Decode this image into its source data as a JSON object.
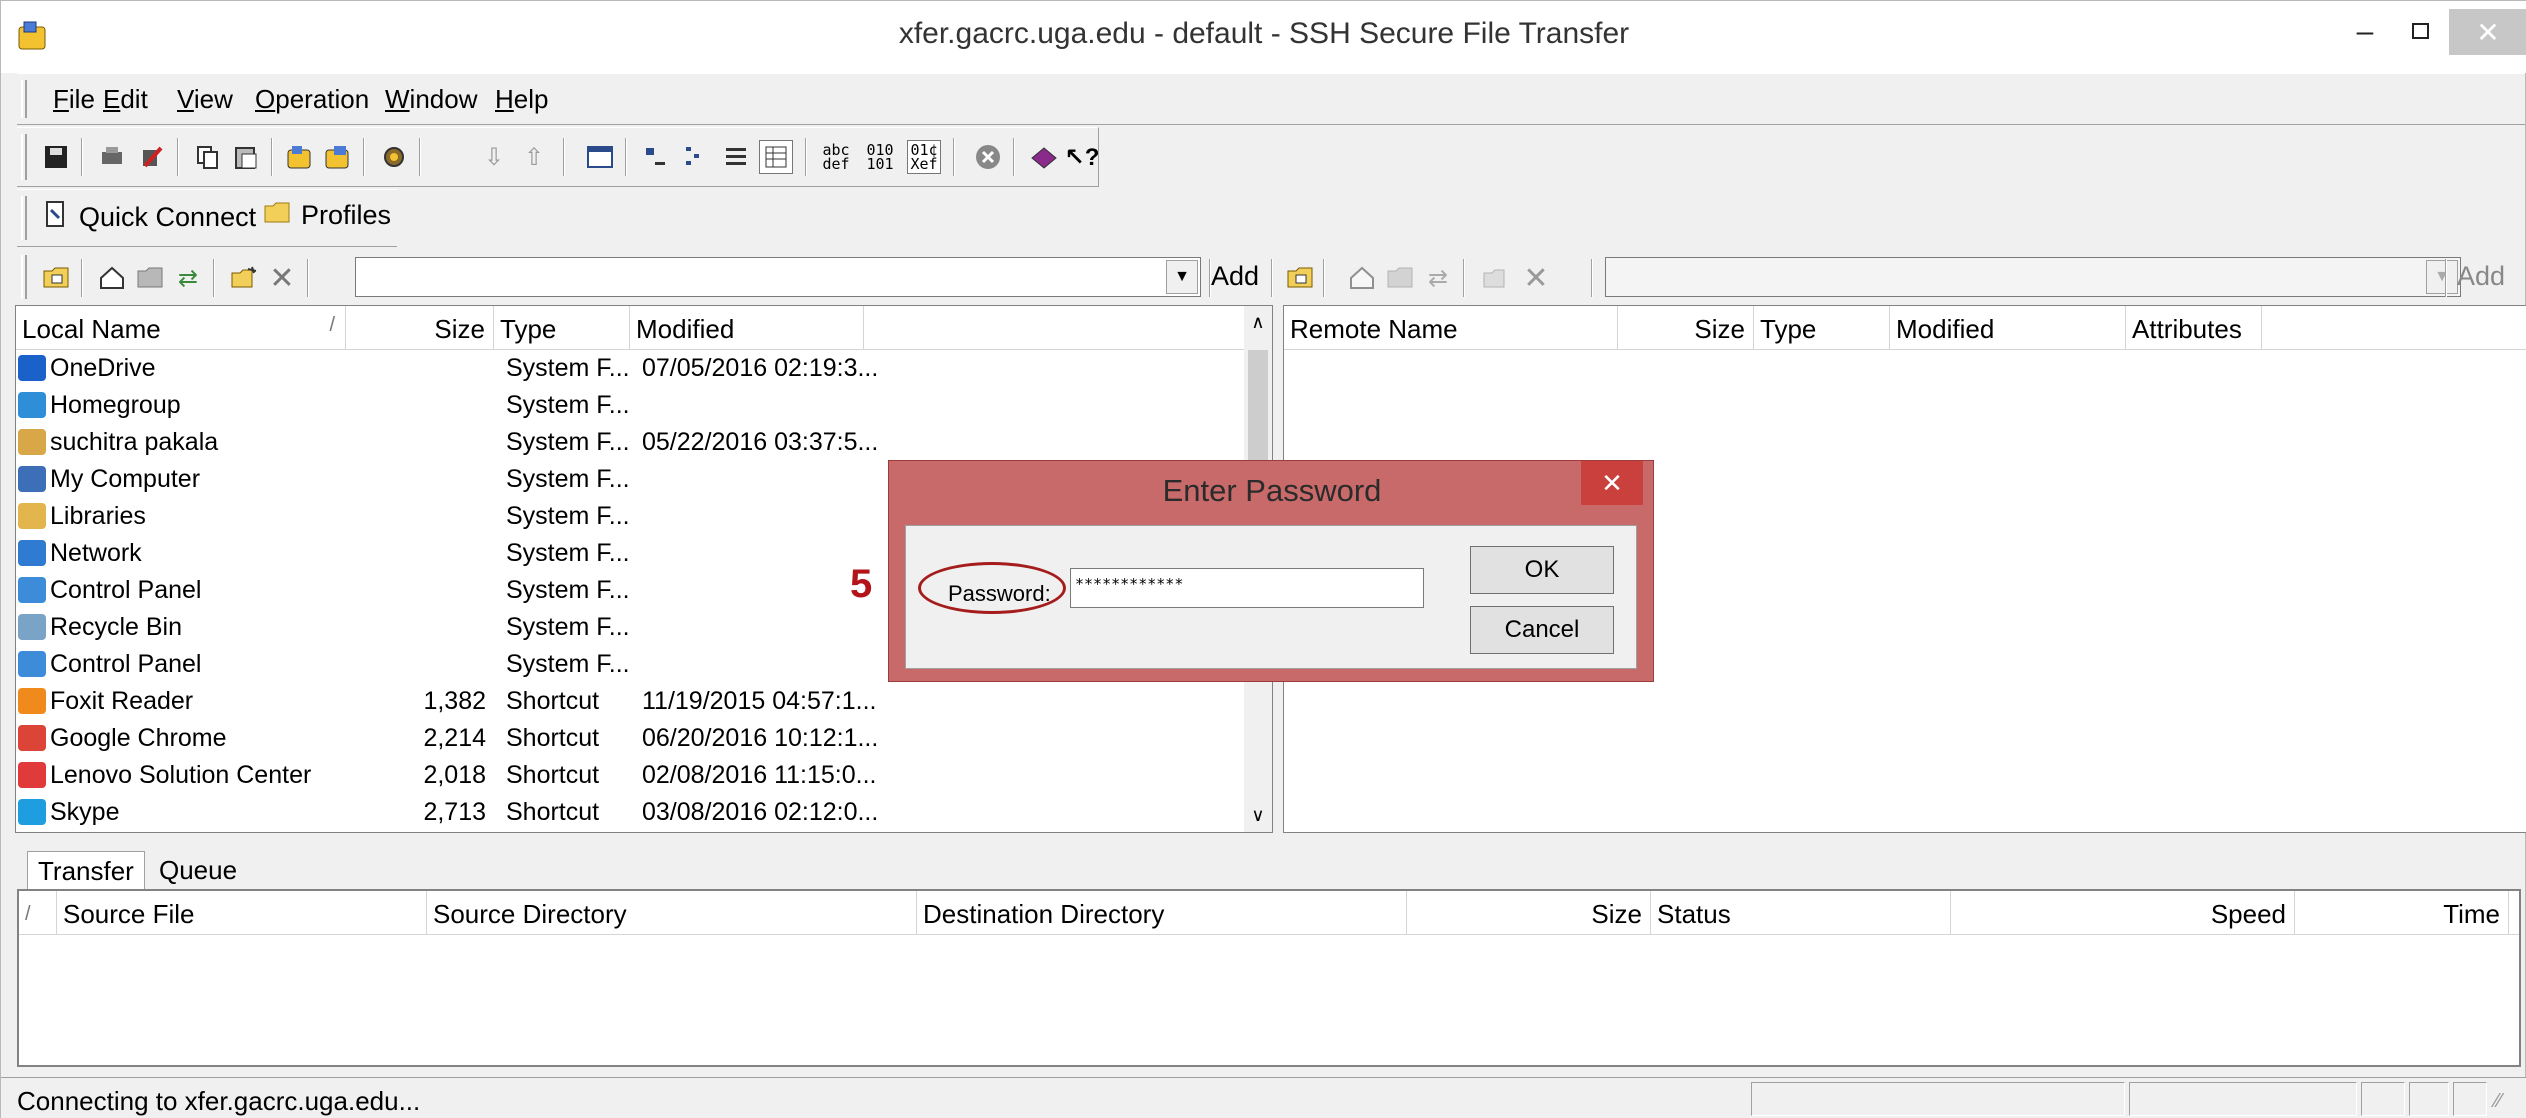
{
  "window": {
    "title": "xfer.gacrc.uga.edu - default - SSH Secure File Transfer",
    "min_glyph": "–",
    "max_glyph": "□",
    "close_glyph": "✕"
  },
  "menu": [
    "File",
    "Edit",
    "View",
    "Operation",
    "Window",
    "Help"
  ],
  "toolbar2": {
    "quick_connect": "Quick Connect",
    "profiles": "Profiles"
  },
  "path_bar": {
    "local_add": "Add",
    "remote_add": "Add",
    "local_path": "",
    "remote_path": ""
  },
  "local_pane": {
    "columns": [
      "Local Name",
      "Size",
      "Type",
      "Modified"
    ],
    "sort_glyph": "/",
    "rows": [
      {
        "name": "OneDrive",
        "size": "",
        "type": "System F...",
        "modified": "07/05/2016 02:19:3...",
        "icon": "onedrive-icon",
        "color": "#1a62c9"
      },
      {
        "name": "Homegroup",
        "size": "",
        "type": "System F...",
        "modified": "",
        "icon": "homegroup-icon",
        "color": "#2e8fd8"
      },
      {
        "name": "suchitra pakala",
        "size": "",
        "type": "System F...",
        "modified": "05/22/2016 03:37:5...",
        "icon": "user-folder-icon",
        "color": "#d8a848"
      },
      {
        "name": "My Computer",
        "size": "",
        "type": "System F...",
        "modified": "",
        "icon": "computer-icon",
        "color": "#3d6fb8"
      },
      {
        "name": "Libraries",
        "size": "",
        "type": "System F...",
        "modified": "",
        "icon": "libraries-icon",
        "color": "#e2b64c"
      },
      {
        "name": "Network",
        "size": "",
        "type": "System F...",
        "modified": "",
        "icon": "network-icon",
        "color": "#2f7bd1"
      },
      {
        "name": "Control Panel",
        "size": "",
        "type": "System F...",
        "modified": "",
        "icon": "control-panel-icon",
        "color": "#3c8cd9"
      },
      {
        "name": "Recycle Bin",
        "size": "",
        "type": "System F...",
        "modified": "",
        "icon": "recycle-bin-icon",
        "color": "#7aa3c8"
      },
      {
        "name": "Control Panel",
        "size": "",
        "type": "System F...",
        "modified": "",
        "icon": "control-panel-icon",
        "color": "#3c8cd9"
      },
      {
        "name": "Foxit Reader",
        "size": "1,382",
        "type": "Shortcut",
        "modified": "11/19/2015 04:57:1...",
        "icon": "foxit-reader-icon",
        "color": "#f08a1c"
      },
      {
        "name": "Google Chrome",
        "size": "2,214",
        "type": "Shortcut",
        "modified": "06/20/2016 10:12:1...",
        "icon": "chrome-icon",
        "color": "#db4437"
      },
      {
        "name": "Lenovo Solution Center",
        "size": "2,018",
        "type": "Shortcut",
        "modified": "02/08/2016 11:15:0...",
        "icon": "lenovo-icon",
        "color": "#e03a3a"
      },
      {
        "name": "Skype",
        "size": "2,713",
        "type": "Shortcut",
        "modified": "03/08/2016 02:12:0...",
        "icon": "skype-icon",
        "color": "#1e9ee0"
      }
    ]
  },
  "remote_pane": {
    "columns": [
      "Remote Name",
      "Size",
      "Type",
      "Modified",
      "Attributes"
    ]
  },
  "transfer": {
    "tabs": [
      "Transfer",
      "Queue"
    ],
    "sort_glyph": "/",
    "columns": [
      "Source File",
      "Source Directory",
      "Destination Directory",
      "Size",
      "Status",
      "Speed",
      "Time"
    ]
  },
  "status": {
    "text": "Connecting to xfer.gacrc.uga.edu..."
  },
  "dialog": {
    "title": "Enter Password",
    "close_glyph": "✕",
    "label": "Password:",
    "value": "************",
    "ok": "OK",
    "cancel": "Cancel"
  },
  "annotation": {
    "step": "5",
    "color": "#b3141a"
  }
}
